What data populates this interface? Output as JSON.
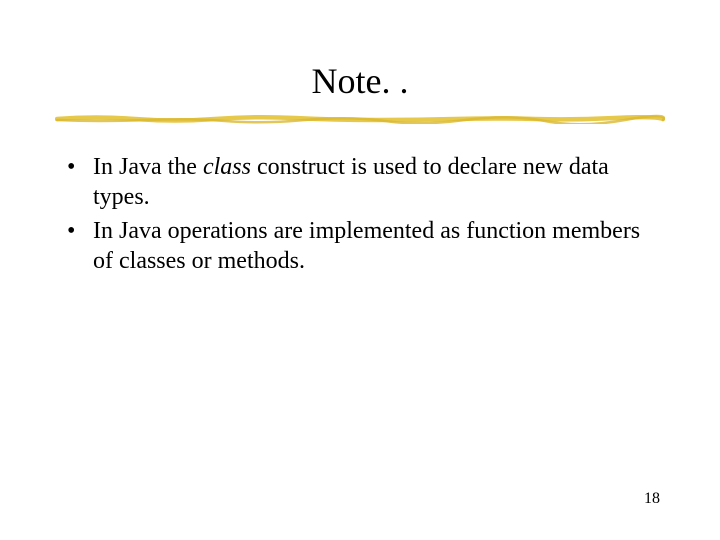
{
  "slide": {
    "title": "Note. .",
    "bullets": [
      {
        "prefix": "In Java the ",
        "italic": "class",
        "suffix": " construct is used to declare new data types."
      },
      {
        "prefix": "In Java operations are implemented as function members of classes or methods.",
        "italic": "",
        "suffix": ""
      }
    ],
    "page_number": "18"
  }
}
